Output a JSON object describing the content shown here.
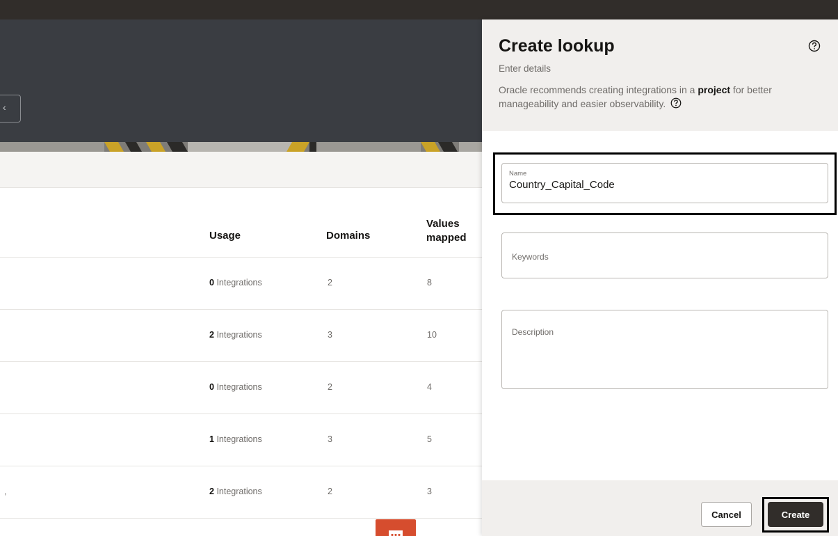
{
  "background_page": {
    "hero_button_glyph": "‹",
    "table": {
      "columns": {
        "usage": "Usage",
        "domains": "Domains",
        "values_mapped": "Values mapped"
      },
      "rows": [
        {
          "usage_count": "0",
          "usage_label": "Integrations",
          "domains": "2",
          "values_mapped": "8",
          "row_mark": ""
        },
        {
          "usage_count": "2",
          "usage_label": "Integrations",
          "domains": "3",
          "values_mapped": "10",
          "row_mark": ""
        },
        {
          "usage_count": "0",
          "usage_label": "Integrations",
          "domains": "2",
          "values_mapped": "4",
          "row_mark": ""
        },
        {
          "usage_count": "1",
          "usage_label": "Integrations",
          "domains": "3",
          "values_mapped": "5",
          "row_mark": ""
        },
        {
          "usage_count": "2",
          "usage_label": "Integrations",
          "domains": "2",
          "values_mapped": "3",
          "row_mark": ","
        }
      ]
    },
    "chat_icon": "chat-bubble-icon"
  },
  "drawer": {
    "title": "Create lookup",
    "subtitle": "Enter details",
    "note_prefix": "Oracle recommends creating integrations in a ",
    "note_bold": "project",
    "note_suffix": " for better manageability and easier observability.",
    "help_icon": "help-circle-icon",
    "fields": {
      "name": {
        "label": "Name",
        "value": "Country_Capital_Code"
      },
      "keywords": {
        "placeholder": "Keywords",
        "value": ""
      },
      "description": {
        "placeholder": "Description",
        "value": ""
      }
    },
    "footer": {
      "cancel_label": "Cancel",
      "create_label": "Create"
    }
  },
  "colors": {
    "topbar": "#312d2a",
    "hero": "#3a3d42",
    "chat_fab": "#d64d2e",
    "primary_button": "#312d2a",
    "drawer_header": "#f1efed"
  }
}
